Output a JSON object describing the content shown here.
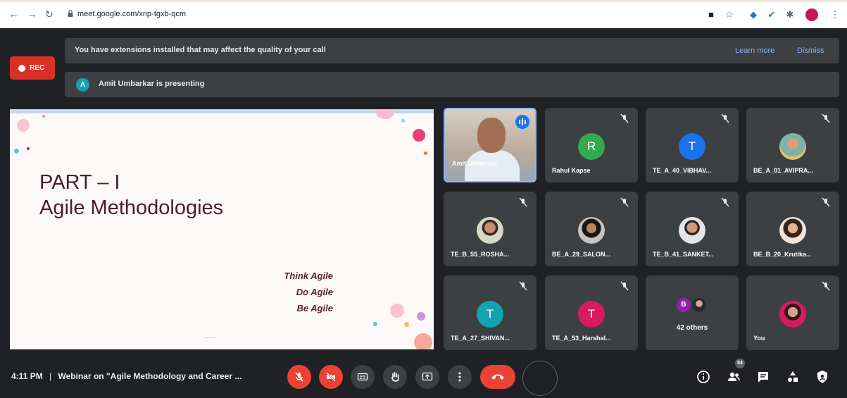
{
  "browser": {
    "url": "meet.google.com/xnp-tgxb-qcm"
  },
  "banners": {
    "extensions_warning": "You have extensions installed that may affect the quality of your call",
    "learn_more": "Learn more",
    "dismiss": "Dismiss",
    "presenter_initial": "A",
    "presenting_text": "Amit Umbarkar is presenting"
  },
  "recording": {
    "label": "REC",
    "color": "#d93025"
  },
  "slide": {
    "title_line1": "PART – I",
    "title_line2": "Agile Methodologies",
    "tagline": [
      "Think Agile",
      "Do Agile",
      "Be Agile"
    ]
  },
  "participants": [
    {
      "name": "Amit Umbarkar",
      "type": "video",
      "speaking": true
    },
    {
      "name": "Rahul Kapse",
      "initial": "R",
      "color": "#34a853",
      "muted": true
    },
    {
      "name": "TE_A_40_VIBHAV...",
      "initial": "T",
      "color": "#1a73e8",
      "muted": true
    },
    {
      "name": "BE_A_01_AVIPRA...",
      "type": "photo",
      "muted": true
    },
    {
      "name": "TE_B_55_ROSHA...",
      "type": "photo",
      "muted": true
    },
    {
      "name": "BE_A_29_SALON...",
      "type": "photo",
      "muted": true
    },
    {
      "name": "TE_B_41_SANKET...",
      "type": "photo",
      "muted": true
    },
    {
      "name": "BE_B_20_Krutika...",
      "type": "photo",
      "muted": true
    },
    {
      "name": "TE_A_27_SHIVAN...",
      "initial": "T",
      "color": "#12a4af",
      "muted": true
    },
    {
      "name": "TE_A_53_Harshal...",
      "initial": "T",
      "color": "#d81b60",
      "muted": true
    },
    {
      "name": "42 others",
      "type": "others",
      "initial": "B"
    },
    {
      "name": "You",
      "type": "photo",
      "muted": true
    }
  ],
  "bottom": {
    "time": "4:11 PM",
    "separator": "|",
    "meeting_title": "Webinar on \"Agile Methodology and Career ...",
    "participant_count": "54"
  },
  "colors": {
    "background": "#202124",
    "tile": "#3c4043",
    "danger": "#ea4335",
    "link": "#8ab4f8"
  }
}
